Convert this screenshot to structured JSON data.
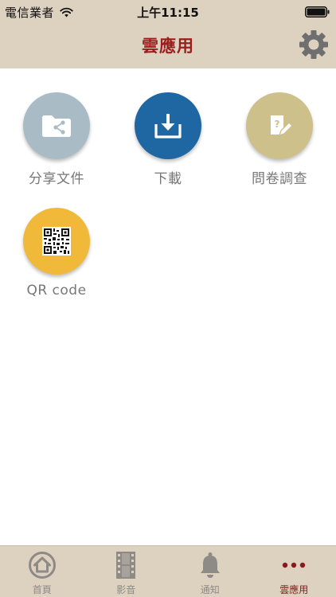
{
  "status_bar": {
    "carrier": "電信業者",
    "time": "上午11:15"
  },
  "header": {
    "title": "雲應用",
    "settings_icon": "gear-icon"
  },
  "apps": [
    {
      "label": "分享文件",
      "icon": "share-folder-icon",
      "color": "#a9bcc6"
    },
    {
      "label": "下載",
      "icon": "download-icon",
      "color": "#1f67a3"
    },
    {
      "label": "問卷調查",
      "icon": "survey-icon",
      "color": "#cdc08a"
    },
    {
      "label": "QR code",
      "icon": "qr-code-icon",
      "color": "#f1b93a"
    }
  ],
  "tab_bar": {
    "tabs": [
      {
        "label": "首頁",
        "icon": "home-icon",
        "active": false
      },
      {
        "label": "影音",
        "icon": "film-icon",
        "active": false
      },
      {
        "label": "通知",
        "icon": "bell-icon",
        "active": false
      },
      {
        "label": "雲應用",
        "icon": "more-icon",
        "active": true
      }
    ]
  },
  "colors": {
    "bar_background": "#ddd1c0",
    "title_red": "#9b1d1d",
    "label_gray": "#777777",
    "tab_inactive": "#8e8a85",
    "tab_active": "#8b1a1a"
  }
}
